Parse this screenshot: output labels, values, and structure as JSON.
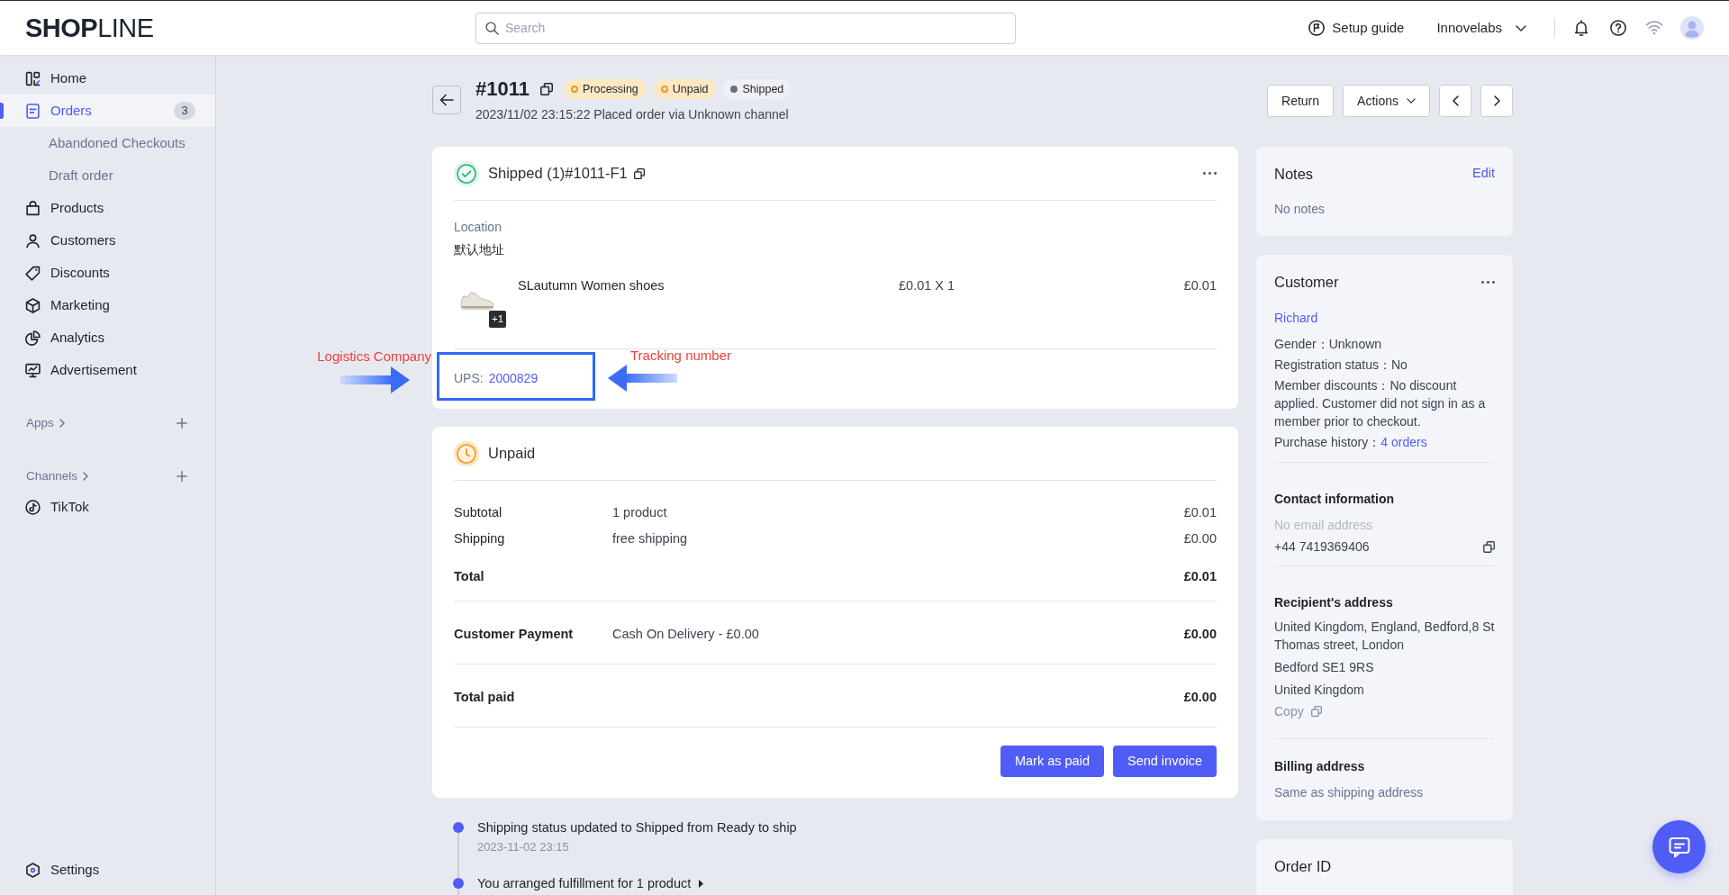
{
  "top_bar": {
    "logo": "**SHOP**LINE",
    "search": {
      "placeholder": "Search"
    },
    "setup_guide": "Setup guide",
    "store": "Innovelabs"
  },
  "sidebar": {
    "items": [
      {
        "label": "Home",
        "selected": false
      },
      {
        "label": "Orders",
        "selected": true,
        "badge": "3",
        "children": [
          {
            "label": "Abandoned Checkouts",
            "selected": false
          },
          {
            "label": "Draft order",
            "selected": false
          }
        ]
      },
      {
        "label": "Products",
        "selected": false
      },
      {
        "label": "Customers",
        "selected": false
      },
      {
        "label": "Discounts",
        "selected": false
      },
      {
        "label": "Marketing",
        "selected": false
      },
      {
        "label": "Analytics",
        "selected": false
      },
      {
        "label": "Advertisement",
        "selected": false
      }
    ],
    "sections": [
      {
        "title": "Apps"
      },
      {
        "title": "Channels",
        "items": [
          {
            "label": "TikTok",
            "selected": false
          }
        ]
      }
    ],
    "settings": {
      "label": "Settings",
      "selected": false
    }
  },
  "order": {
    "number": "#1011",
    "badges": [
      {
        "label": "Processing",
        "kind": "warning",
        "color": "#f59a1b"
      },
      {
        "label": "Unpaid",
        "kind": "warning",
        "color": "#f59a1b"
      },
      {
        "label": "Shipped",
        "kind": "neutral",
        "color": "#6b7280"
      }
    ],
    "subtitle": "2023/11/02 23:15:22 Placed order via Unknown channel",
    "actions": [
      {
        "label": "Return",
        "kind": "plain"
      },
      {
        "label": "Actions",
        "kind": "dropdown"
      }
    ]
  },
  "fulfillment": {
    "title": "Shipped (1)#1011-F1",
    "location_label": "Location",
    "location": "默认地址",
    "items": [
      {
        "name": "SLautumn Women shoes",
        "price": "£0.01 X 1",
        "total": "£0.01",
        "more_count": "+1"
      }
    ],
    "tracking": {
      "carrier": "UPS:",
      "number": "2000829"
    },
    "annotations": [
      {
        "text": "Logistics Company",
        "kind": "points-right"
      },
      {
        "text": "Tracking number",
        "kind": "points-left"
      }
    ]
  },
  "payment": {
    "title": "Unpaid",
    "sections": [
      {
        "rows": [
          {
            "kind": "line",
            "label": "Subtotal",
            "detail": "1 product",
            "amount": "£0.01"
          },
          {
            "kind": "line",
            "label": "Shipping",
            "detail": "free shipping",
            "amount": "£0.00"
          },
          {
            "kind": "total",
            "label": "Total",
            "amount": "£0.01"
          }
        ]
      },
      {
        "rows": [
          {
            "kind": "total",
            "label": "Customer Payment",
            "detail": "Cash On Delivery - £0.00",
            "amount": "£0.00"
          }
        ]
      },
      {
        "rows": [
          {
            "kind": "total",
            "label": "Total paid",
            "amount": "£0.00"
          }
        ]
      }
    ],
    "buttons": [
      "Mark as paid",
      "Send invoice"
    ]
  },
  "timeline": [
    {
      "text": "Shipping status updated to Shipped from Ready to ship",
      "time": "2023-11-02 23:15",
      "collapsible": false
    },
    {
      "text": "You arranged fulfillment for 1 product",
      "collapsible": true
    }
  ],
  "notes": {
    "title": "Notes",
    "action": "Edit",
    "body": "No notes"
  },
  "customer": {
    "title": "Customer",
    "name": "Richard",
    "fields": [
      {
        "kind": "text",
        "label": "Gender：",
        "value": "Unknown"
      },
      {
        "kind": "text",
        "label": "Registration status：",
        "value": "No"
      },
      {
        "kind": "text",
        "label": "Member discounts：",
        "value": "No discount applied. Customer did not sign in as a member prior to checkout."
      },
      {
        "kind": "link",
        "label": "Purchase history：",
        "value": "4 orders"
      }
    ],
    "contact": {
      "title": "Contact information",
      "email": "No email address",
      "phone": "+44 7419369406"
    },
    "recipient_address": {
      "title": "Recipient's address",
      "lines": [
        "United Kingdom, England, Bedford,8 St Thomas street, London",
        "Bedford SE1 9RS",
        "United Kingdom"
      ],
      "copy": "Copy"
    },
    "billing_address": {
      "title": "Billing address",
      "body": "Same as shipping address"
    }
  },
  "order_id": {
    "title": "Order ID"
  }
}
